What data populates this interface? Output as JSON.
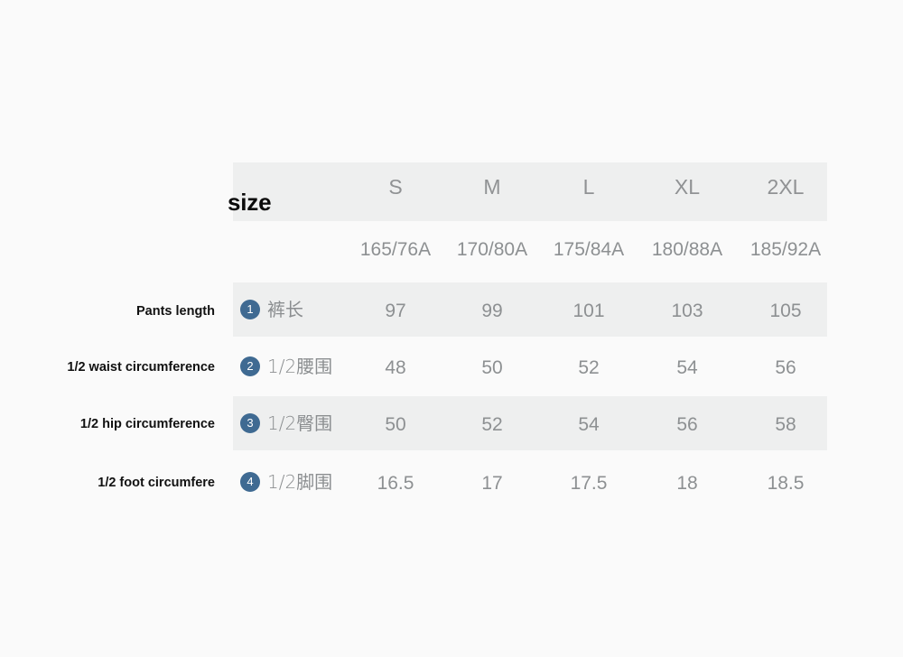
{
  "chart_data": {
    "type": "table",
    "title": "size",
    "legend_position": "none",
    "grid": false,
    "row_header_label": "size",
    "categories": [
      "S",
      "M",
      "L",
      "XL",
      "2XL"
    ],
    "spec_codes": [
      "165/76A",
      "170/80A",
      "175/84A",
      "180/88A",
      "185/92A"
    ],
    "row_names_en": [
      "Pants length",
      "1/2 waist circumference",
      "1/2 hip circumference",
      "1/2 foot circumfere"
    ],
    "row_names_cn": [
      "裤长",
      "1/2腰围",
      "1/2臀围",
      "1/2脚围"
    ],
    "row_numbers": [
      "1",
      "2",
      "3",
      "4"
    ],
    "series": [
      {
        "name": "裤长",
        "values": [
          "97",
          "99",
          "101",
          "103",
          "105"
        ]
      },
      {
        "name": "1/2腰围",
        "values": [
          "48",
          "50",
          "52",
          "54",
          "56"
        ]
      },
      {
        "name": "1/2臀围",
        "values": [
          "50",
          "52",
          "54",
          "56",
          "58"
        ]
      },
      {
        "name": "1/2脚围",
        "values": [
          "16.5",
          "17",
          "17.5",
          "18",
          "18.5"
        ]
      }
    ]
  },
  "header": {
    "size_word": "size",
    "sizes": [
      "S",
      "M",
      "L",
      "XL",
      "2XL"
    ],
    "specs": [
      "165/76A",
      "170/80A",
      "175/84A",
      "180/88A",
      "185/92A"
    ]
  },
  "rows": [
    {
      "number": "1",
      "label_en": "Pants length",
      "label_cn": "裤长",
      "values": [
        "97",
        "99",
        "101",
        "103",
        "105"
      ],
      "banded": true
    },
    {
      "number": "2",
      "label_en": "1/2 waist circumference",
      "label_cn": "1/2腰围",
      "values": [
        "48",
        "50",
        "52",
        "54",
        "56"
      ],
      "banded": false
    },
    {
      "number": "3",
      "label_en": "1/2 hip circumference",
      "label_cn": "1/2臀围",
      "values": [
        "50",
        "52",
        "54",
        "56",
        "58"
      ],
      "banded": true
    },
    {
      "number": "4",
      "label_en": "1/2 foot circumfere",
      "label_cn": "1/2脚围",
      "values": [
        "16.5",
        "17",
        "17.5",
        "18",
        "18.5"
      ],
      "banded": false
    }
  ],
  "colors": {
    "page_background": "#fafafa",
    "band": "#eeefef",
    "badge": "#3f6a92",
    "badge_text": "#ffffff",
    "muted_text": "#8d9092",
    "label_text": "#111111"
  }
}
